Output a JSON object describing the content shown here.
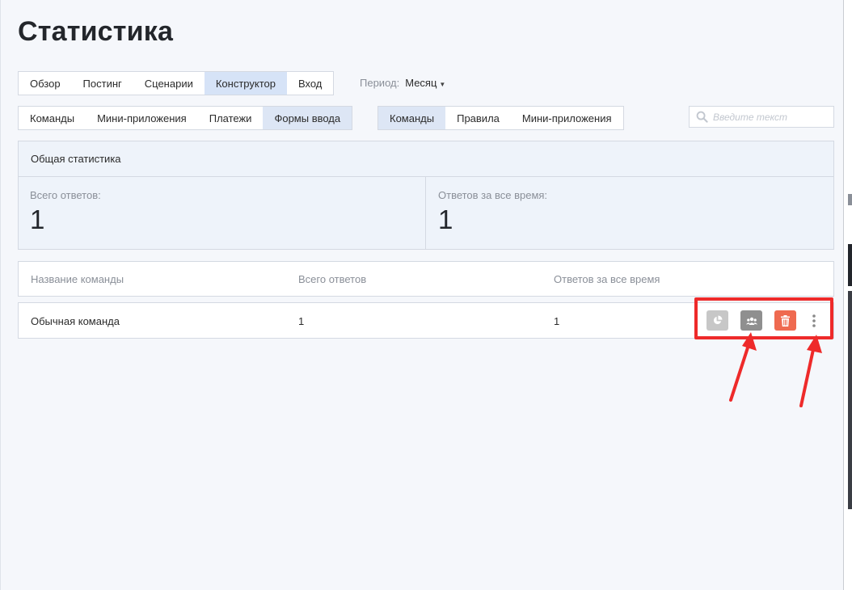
{
  "page": {
    "title": "Статистика"
  },
  "tabs_main": [
    {
      "label": "Обзор",
      "active": false
    },
    {
      "label": "Постинг",
      "active": false
    },
    {
      "label": "Сценарии",
      "active": false
    },
    {
      "label": "Конструктор",
      "active": true
    },
    {
      "label": "Вход",
      "active": false
    }
  ],
  "period": {
    "label": "Период:",
    "value": "Месяц"
  },
  "tabs_sub": [
    {
      "label": "Команды",
      "active": false
    },
    {
      "label": "Мини-приложения",
      "active": false
    },
    {
      "label": "Платежи",
      "active": false
    },
    {
      "label": "Формы ввода",
      "active": true
    }
  ],
  "tabs_third": [
    {
      "label": "Команды",
      "active": true
    },
    {
      "label": "Правила",
      "active": false
    },
    {
      "label": "Мини-приложения",
      "active": false
    }
  ],
  "search": {
    "placeholder": "Введите текст",
    "value": ""
  },
  "stats": {
    "header": "Общая статистика",
    "total_label": "Всего ответов:",
    "total_value": "1",
    "alltime_label": "Ответов за все время:",
    "alltime_value": "1"
  },
  "table": {
    "columns": [
      "Название команды",
      "Всего ответов",
      "Ответов за все время"
    ],
    "rows": [
      {
        "name": "Обычная команда",
        "total": "1",
        "alltime": "1"
      }
    ]
  },
  "row_actions": [
    {
      "name": "stats-button",
      "icon": "pie-chart-icon",
      "color": "#c7c7c7"
    },
    {
      "name": "users-button",
      "icon": "users-icon",
      "color": "#8f8f8f"
    },
    {
      "name": "delete-button",
      "icon": "trash-icon",
      "color": "#ef6a50"
    },
    {
      "name": "more-button",
      "icon": "more-vertical-icon",
      "color": "transparent"
    }
  ],
  "annotation_color": "#ee2a2a"
}
